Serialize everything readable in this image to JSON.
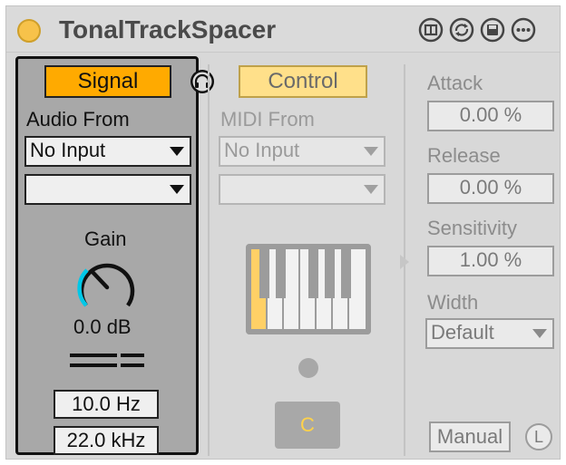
{
  "device": {
    "title": "TonalTrackSpacer",
    "colors": {
      "power": "#f7c24a",
      "signal_active": "#ffaa00",
      "control_inactive": "#ffe08a",
      "panel_bg": "#d8d8d8",
      "signal_panel_bg": "#a8a8a8",
      "gain_arc": "#00c8e8"
    },
    "titlebar_icons": [
      "view-toggle-icon",
      "hot-swap-icon",
      "save-preset-icon",
      "more-options-icon"
    ]
  },
  "signal": {
    "tab_label": "Signal",
    "headphone_icon": "headphone-icon",
    "audio_from_label": "Audio From",
    "audio_from_value": "No Input",
    "audio_channel_value": "",
    "gain_label": "Gain",
    "gain_value": "0.0 dB",
    "filter_icon": "filter-bars-icon",
    "low_freq": "10.0 Hz",
    "high_freq": "22.0 kHz"
  },
  "control": {
    "tab_label": "Control",
    "midi_from_label": "MIDI From",
    "midi_from_value": "No Input",
    "midi_channel_value": "",
    "note_button": "C"
  },
  "params": {
    "attack_label": "Attack",
    "attack_value": "0.00 %",
    "release_label": "Release",
    "release_value": "0.00 %",
    "sensitivity_label": "Sensitivity",
    "sensitivity_value": "1.00 %",
    "width_label": "Width",
    "width_value": "Default",
    "manual_label": "Manual",
    "l_label": "L"
  }
}
